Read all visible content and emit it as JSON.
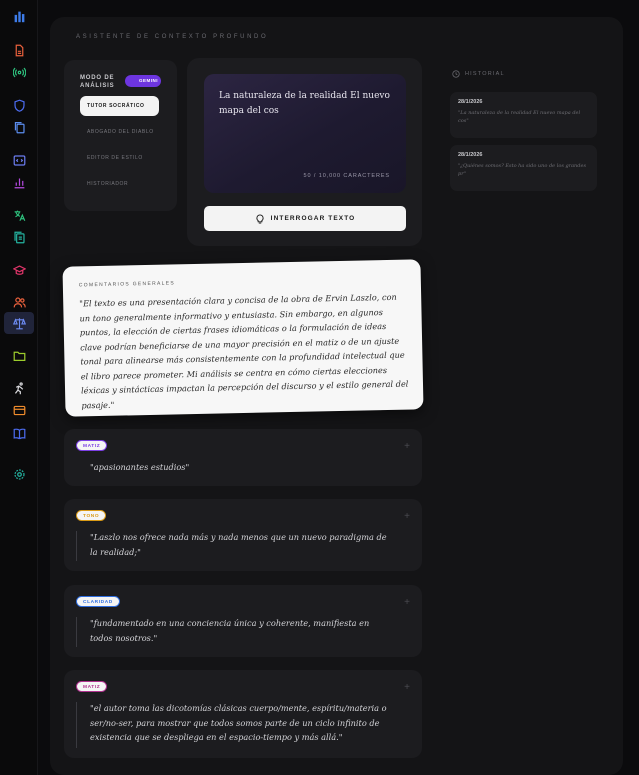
{
  "sidebar": {
    "icons": [
      {
        "name": "logo-icon"
      },
      {
        "name": "file-icon"
      },
      {
        "name": "broadcast-icon"
      },
      {
        "name": "shield-icon"
      },
      {
        "name": "copy-icon"
      },
      {
        "name": "code-icon"
      },
      {
        "name": "bar-chart-icon"
      },
      {
        "name": "translate-icon"
      },
      {
        "name": "files-icon"
      },
      {
        "name": "graduation-cap-icon"
      },
      {
        "name": "users-icon"
      },
      {
        "name": "scale-icon"
      },
      {
        "name": "folder-icon"
      },
      {
        "name": "run-icon"
      },
      {
        "name": "card-icon"
      },
      {
        "name": "book-icon"
      },
      {
        "name": "settings-icon"
      }
    ]
  },
  "page": {
    "title": "Asistente de contexto profundo"
  },
  "mode": {
    "label": "Modo de análisis",
    "toggle_label": "GEMINI",
    "items": [
      "Tutor socrático",
      "Abogado del diablo",
      "Editor de estilo",
      "Historiador"
    ],
    "active_index": 0
  },
  "input": {
    "text": "La naturaleza de la realidad El nuevo mapa del cos",
    "char_count": "50 / 10,000 caracteres",
    "button_label": "INTERROGAR TEXTO"
  },
  "history": {
    "title": "Historial",
    "items": [
      {
        "date": "28/1/2026",
        "text": "\"La naturaleza de la realidad El nuevo mapa del cos\""
      },
      {
        "date": "28/1/2026",
        "text": "\"¿Quiénes somos? Esto ha sido uno de los grandes pr\""
      }
    ]
  },
  "general": {
    "title": "Comentarios generales",
    "text": "\"El texto es una presentación clara y concisa de la obra de Ervin Laszlo, con un tono generalmente informativo y entusiasta. Sin embargo, en algunos puntos, la elección de ciertas frases idiomáticas o la formulación de ideas clave podrían beneficiarse de una mayor precisión en el matiz o de un ajuste tonal para alinearse más consistentemente con la profundidad intelectual que el libro parece prometer. Mi análisis se centra en cómo ciertas elecciones léxicas y sintácticas impactan la percepción del discurso y el estilo general del pasaje.\""
  },
  "notes": [
    {
      "badge": "Matiz",
      "badge_color": "#7b3fe4",
      "text": "\"apasionantes estudios\""
    },
    {
      "badge": "Tono",
      "badge_color": "#d99a16",
      "text": "\"Laszlo nos ofrece nada más y nada menos que un nuevo paradigma de la realidad;\""
    },
    {
      "badge": "Claridad",
      "badge_color": "#2f6ee0",
      "text": "\"fundamentado en una conciencia única y coherente, manifiesta en todos nosotros.\""
    },
    {
      "badge": "Matiz",
      "badge_color": "#b0328f",
      "text": "\"el autor toma las dicotomías clásicas cuerpo/mente, espíritu/materia o ser/no-ser, para mostrar que todos somos parte de un ciclo infinito de existencia que se despliega en el espacio-tiempo y más allá.\""
    }
  ]
}
